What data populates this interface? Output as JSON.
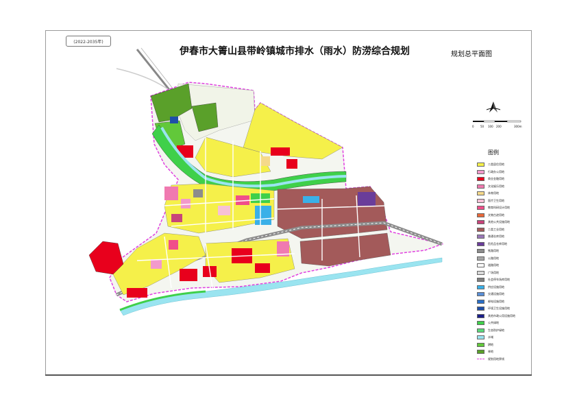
{
  "map": {
    "period": "(2022-2035年)",
    "title": "伊春市大箐山县带岭镇城市排水（雨水）防涝综合规划",
    "subtitle": "规划总平面图",
    "scale_labels": [
      "0",
      "50",
      "100",
      "200",
      "300m"
    ]
  },
  "legend": {
    "title": "图例",
    "items": [
      {
        "label": "二类居住用地",
        "color": "#f5f04a"
      },
      {
        "label": "行政办公用地",
        "color": "#f29acb"
      },
      {
        "label": "商业金融用地",
        "color": "#e8001c"
      },
      {
        "label": "文化娱乐用地",
        "color": "#f07ab0"
      },
      {
        "label": "体育用地",
        "color": "#f5d98a"
      },
      {
        "label": "医疗卫生用地",
        "color": "#f7c1d7"
      },
      {
        "label": "教育科研设计用地",
        "color": "#f04e8a"
      },
      {
        "label": "文物古迹用地",
        "color": "#e8683a"
      },
      {
        "label": "其他公共设施用地",
        "color": "#c8447a"
      },
      {
        "label": "二类工业用地",
        "color": "#a35a5a"
      },
      {
        "label": "普通仓库用地",
        "color": "#9a77b8"
      },
      {
        "label": "危险品仓库用地",
        "color": "#6a3d9a"
      },
      {
        "label": "铁路用地",
        "color": "#8c8c8c"
      },
      {
        "label": "公路用地",
        "color": "#a6a6a6"
      },
      {
        "label": "道路用地",
        "color": "#ffffff"
      },
      {
        "label": "广场用地",
        "color": "#d9d9d9"
      },
      {
        "label": "社会停车场库用地",
        "color": "#7f7f7f"
      },
      {
        "label": "供应设施用地",
        "color": "#3ab0e8"
      },
      {
        "label": "交通设施用地",
        "color": "#5a8fd6"
      },
      {
        "label": "邮电设施用地",
        "color": "#2a6fc8"
      },
      {
        "label": "环境卫生设施用地",
        "color": "#1f4fa8"
      },
      {
        "label": "其他市政公用设施用地",
        "color": "#1a1f8a"
      },
      {
        "label": "公共绿地",
        "color": "#3fd04a"
      },
      {
        "label": "生态防护绿地",
        "color": "#5ad87a"
      },
      {
        "label": "水域",
        "color": "#9ae4f0"
      },
      {
        "label": "耕地",
        "color": "#62c83a"
      },
      {
        "label": "林地",
        "color": "#5aa02a"
      },
      {
        "label": "规划用地界线",
        "color": "#e040e0"
      }
    ]
  }
}
